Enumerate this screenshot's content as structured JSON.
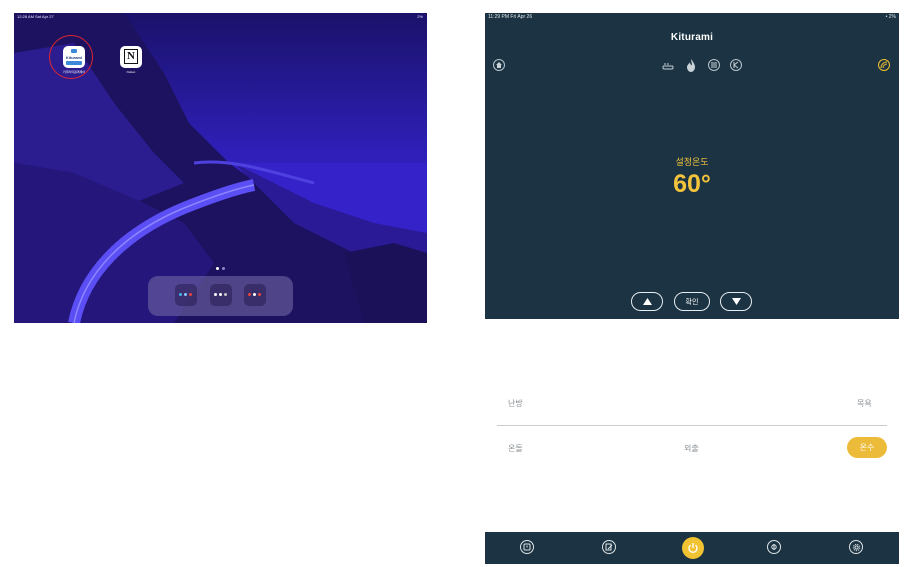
{
  "ipad": {
    "status_left": "12:28 AM  Sat Apr 27",
    "status_right": "2%",
    "apps": [
      {
        "name": "Kiturami",
        "label": "키뚜라미원격제어"
      },
      {
        "name": "Notion",
        "label": "Notion"
      }
    ]
  },
  "app": {
    "status_time": "11:29 PM  Fri Apr 26",
    "status_battery": "2%",
    "logo": "Kiturami",
    "set_temp_label": "설정온도",
    "set_temp_value": "60°",
    "up_icon": "triangle-up-icon",
    "confirm_label": "확인",
    "down_icon": "triangle-down-icon",
    "modes": {
      "heating": "난방",
      "bath": "목욕",
      "ondol": "온돌",
      "away": "외출",
      "hot_water": "온수"
    },
    "nav_icons": [
      "timer-icon",
      "schedule-edit-icon",
      "power-icon",
      "boiler-icon",
      "settings-icon"
    ],
    "accent": "#f1c231",
    "panel": "#1b3342"
  }
}
